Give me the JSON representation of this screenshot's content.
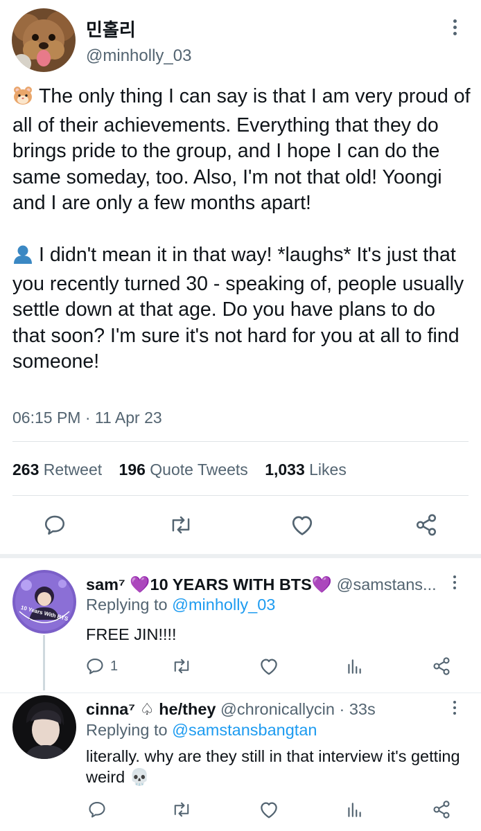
{
  "main_tweet": {
    "author_name": "민홀리",
    "author_handle": "@minholly_03",
    "avatar_icon": "dog-avatar",
    "paragraph_1_emoji": "hamster-icon",
    "paragraph_1": "The only thing I can say is that I am very proud of all of their achievements. Everything that they do brings pride to the group, and I hope I can do the same someday, too. Also, I'm not that old! Yoongi and I are only a few months apart!",
    "paragraph_2_emoji": "person-silhouette-icon",
    "paragraph_2": "I didn't mean it in that way! *laughs* It's just that you recently turned 30 - speaking of, people usually settle down at that age. Do you have plans to do that soon? I'm sure it's not hard for you at all to find someone!",
    "timestamp": "06:15 PM · 11 Apr 23",
    "stats": {
      "retweets_count": "263",
      "retweets_label": "Retweet",
      "quotes_count": "196",
      "quotes_label": "Quote Tweets",
      "likes_count": "1,033",
      "likes_label": "Likes"
    }
  },
  "replies": [
    {
      "author_name": "sam⁷ 💜10 YEARS WITH BTS💜",
      "author_handle": "@samstans...",
      "avatar_text": "10 Years With BTS",
      "replying_prefix": "Replying to",
      "replying_to": "@minholly_03",
      "text": "FREE JIN!!!!",
      "reply_count": "1"
    },
    {
      "author_name": "cinna⁷ ♤ he/they",
      "author_handle": "@chronicallycin · 33s",
      "replying_prefix": "Replying to",
      "replying_to": "@samstansbangtan",
      "text": "literally. why are they still in that interview it's getting weird 💀",
      "reply_count": ""
    }
  ],
  "colors": {
    "text": "#0f1419",
    "muted": "#536471",
    "link": "#1d9bf0",
    "divider": "#eceff1"
  }
}
